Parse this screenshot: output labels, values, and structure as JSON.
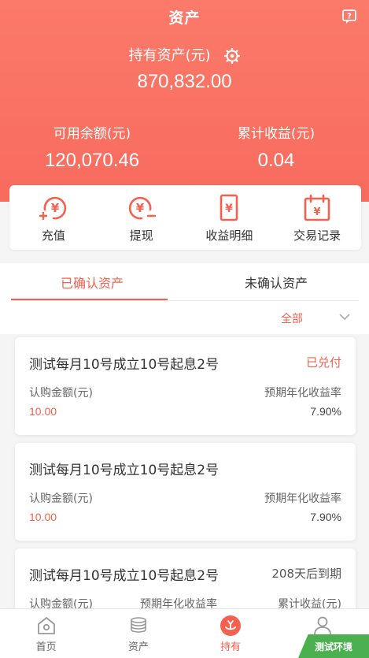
{
  "header": {
    "title": "资产",
    "holding_label": "持有资产(元)",
    "holding_value": "870,832.00",
    "available_label": "可用余额(元)",
    "available_value": "120,070.46",
    "cumulative_label": "累计收益(元)",
    "cumulative_value": "0.04"
  },
  "quick_actions": [
    {
      "label": "充值",
      "icon": "recharge-icon"
    },
    {
      "label": "提现",
      "icon": "withdraw-icon"
    },
    {
      "label": "收益明细",
      "icon": "income-detail-icon"
    },
    {
      "label": "交易记录",
      "icon": "transaction-record-icon"
    }
  ],
  "tabs": [
    {
      "label": "已确认资产",
      "active": true
    },
    {
      "label": "未确认资产",
      "active": false
    }
  ],
  "filter": {
    "label": "全部"
  },
  "assets": [
    {
      "name": "测试每月10号成立10号起息2号",
      "status": "已兑付",
      "amount_label": "认购金额(元)",
      "amount_value": "10.00",
      "rate_label": "预期年化收益率",
      "rate_value": "7.90%"
    },
    {
      "name": "测试每月10号成立10号起息2号",
      "status": "",
      "amount_label": "认购金额(元)",
      "amount_value": "10.00",
      "rate_label": "预期年化收益率",
      "rate_value": "7.90%"
    },
    {
      "name": "测试每月10号成立10号起息2号",
      "status": "208天后到期",
      "amount_label": "认购金额(元)",
      "rate_label": "预期年化收益率",
      "cumulative_label": "累计收益(元)"
    }
  ],
  "bottom_nav": [
    {
      "label": "首页",
      "icon": "home-icon",
      "active": false
    },
    {
      "label": "资产",
      "icon": "coins-icon",
      "active": false
    },
    {
      "label": "持有",
      "icon": "holding-icon",
      "active": true
    },
    {
      "label": "",
      "icon": "user-icon",
      "active": false
    }
  ],
  "env_badge": "测试环境",
  "colors": {
    "accent": "#f5604f",
    "hero_top": "#fb7a6a",
    "hero_bottom": "#f86b5e",
    "badge": "#4caf50"
  }
}
